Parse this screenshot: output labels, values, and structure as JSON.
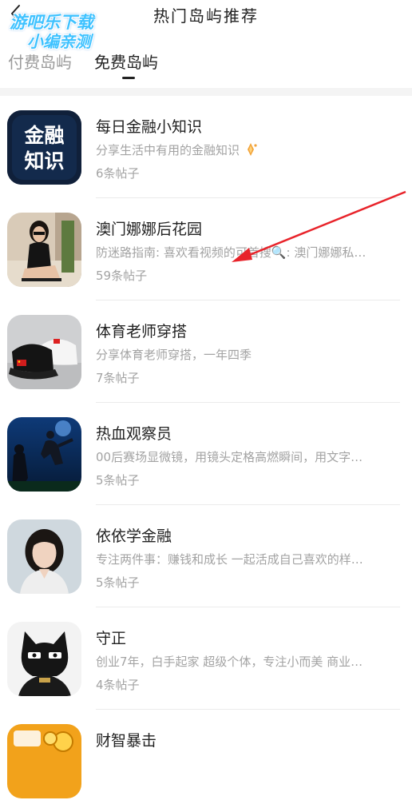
{
  "header": {
    "title": "热门岛屿推荐",
    "back_icon": "chevron-left-icon"
  },
  "watermark": {
    "line1": "游吧乐下载",
    "line2": "小编亲测"
  },
  "tabs": [
    {
      "label": "付费岛屿",
      "active": false
    },
    {
      "label": "免费岛屿",
      "active": true
    }
  ],
  "colors": {
    "text_primary": "#222222",
    "text_secondary": "#a3a3a3",
    "tab_inactive": "#9a9a9a",
    "annotation_arrow": "#e8232a",
    "watermark": "#3fc2ff"
  },
  "islands": [
    {
      "title": "每日金融小知识",
      "desc": "分享生活中有用的金融知识",
      "count": "6条帖子",
      "avatar_text_1": "金融",
      "avatar_text_2": "知识",
      "desc_icon": "diamond-sparkle-icon"
    },
    {
      "title": "澳门娜娜后花园",
      "desc": "防迷路指南: 喜欢看视频的可首搜🔍: 澳门娜娜私…",
      "count": "59条帖子"
    },
    {
      "title": "体育老师穿搭",
      "desc": "分享体育老师穿搭，一年四季",
      "count": "7条帖子"
    },
    {
      "title": "热血观察员",
      "desc": "00后赛场显微镜，用镜头定格高燃瞬间，用文字…",
      "count": "5条帖子"
    },
    {
      "title": "依依学金融",
      "desc": "专注两件事：赚钱和成长 一起活成自己喜欢的样…",
      "count": "5条帖子"
    },
    {
      "title": "守正",
      "desc": "创业7年，白手起家 超级个体，专注小而美 商业…",
      "count": "4条帖子"
    },
    {
      "title": "财智暴击",
      "desc": "",
      "count": ""
    }
  ]
}
